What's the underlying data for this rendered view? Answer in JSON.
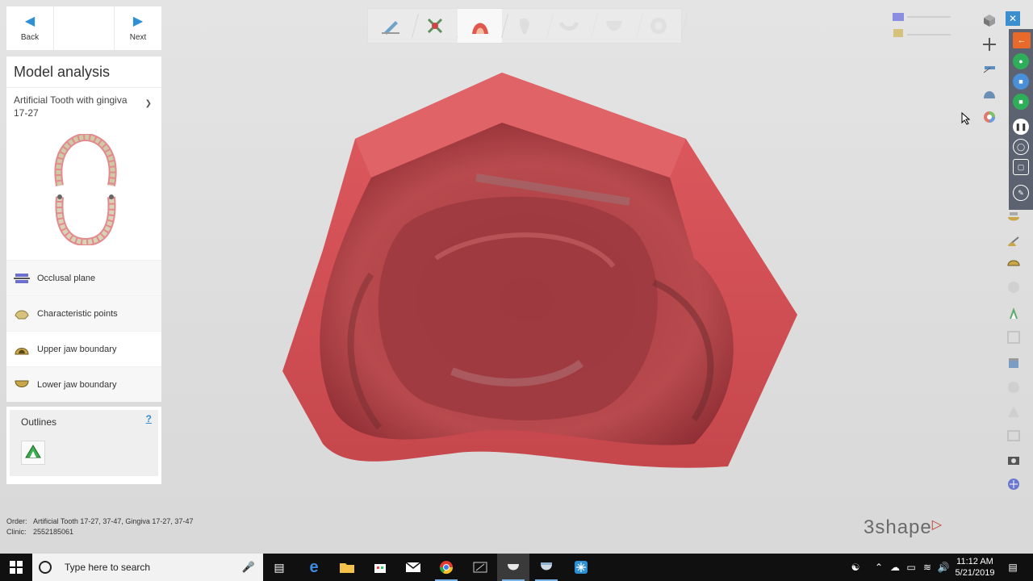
{
  "nav": {
    "back_label": "Back",
    "next_label": "Next"
  },
  "panel": {
    "title": "Model analysis",
    "order_line1": "Artificial Tooth with gingiva",
    "order_line2": "17-27",
    "steps": [
      {
        "label": "Occlusal plane",
        "icon": "occlusal-plane-icon"
      },
      {
        "label": "Characteristic points",
        "icon": "characteristic-points-icon"
      },
      {
        "label": "Upper jaw boundary",
        "icon": "upper-jaw-icon",
        "active": true
      },
      {
        "label": "Lower jaw boundary",
        "icon": "lower-jaw-icon"
      }
    ]
  },
  "outlines": {
    "title": "Outlines",
    "help": "?"
  },
  "workflow_steps": [
    "scan-tool",
    "trim-tool",
    "model-analysis",
    "teeth-setup",
    "gingiva",
    "cutback",
    "export"
  ],
  "footer": {
    "order_key": "Order:",
    "order_value": "Artificial Tooth 17-27, 37-47, Gingiva 17-27, 37-47",
    "clinic_key": "Clinic:",
    "clinic_value": "2552185061",
    "brand": "3shape"
  },
  "taskbar": {
    "search_placeholder": "Type here to search",
    "time": "11:12 AM",
    "date": "5/21/2019"
  },
  "colors": {
    "accent": "#2d8fd5",
    "model_red": "#c7434a",
    "taskbar": "#101010"
  }
}
